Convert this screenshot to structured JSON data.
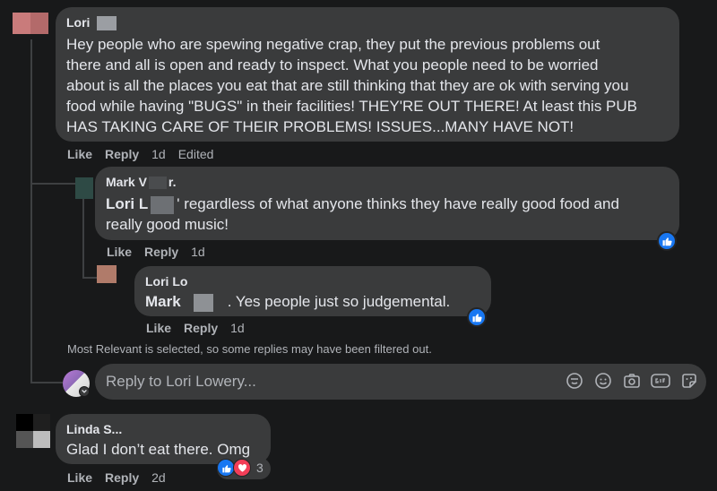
{
  "comments": [
    {
      "author": "Lori",
      "text_lines": [
        "Hey people who are spewing negative crap, they put the previous problems out",
        "there and all is open and ready to inspect. What you people need to be worried",
        "about is all the places you eat that are still thinking that they are ok with serving you",
        "food while having \"BUGS\" in their facilities! THEY'RE OUT THERE! At least this PUB",
        "HAS TAKING CARE OF THEIR PROBLEMS! ISSUES...MANY HAVE NOT!"
      ],
      "like": "Like",
      "reply": "Reply",
      "time": "1d",
      "edited": "Edited"
    },
    {
      "author": "Mark V",
      "author_tail": "r.",
      "mention": "Lori L",
      "text_first": "' regardless of what anyone thinks they have really good food and",
      "text_second": "really good music!",
      "like": "Like",
      "reply": "Reply",
      "time": "1d"
    },
    {
      "author": "Lori Lo",
      "mention": "Mark",
      "text": ". Yes people just so judgemental.",
      "like": "Like",
      "reply": "Reply",
      "time": "1d"
    },
    {
      "author": "Linda S...",
      "text": "Glad I don’t eat there. Omg",
      "like": "Like",
      "reply": "Reply",
      "time": "2d",
      "reaction_count": "3"
    }
  ],
  "filter_note": "Most Relevant is selected, so some replies may have been filtered out.",
  "reply_box": {
    "placeholder": "Reply to Lori Lowery..."
  },
  "icons": [
    "sticker-icon",
    "emoji-icon",
    "camera-icon",
    "gif-icon",
    "sticker-alt-icon"
  ],
  "colors": {
    "background": "#18191a",
    "bubble": "#3a3b3c",
    "like_blue": "#1877f2",
    "love_red": "#f33e58",
    "secondary_text": "#b0b3b8"
  }
}
